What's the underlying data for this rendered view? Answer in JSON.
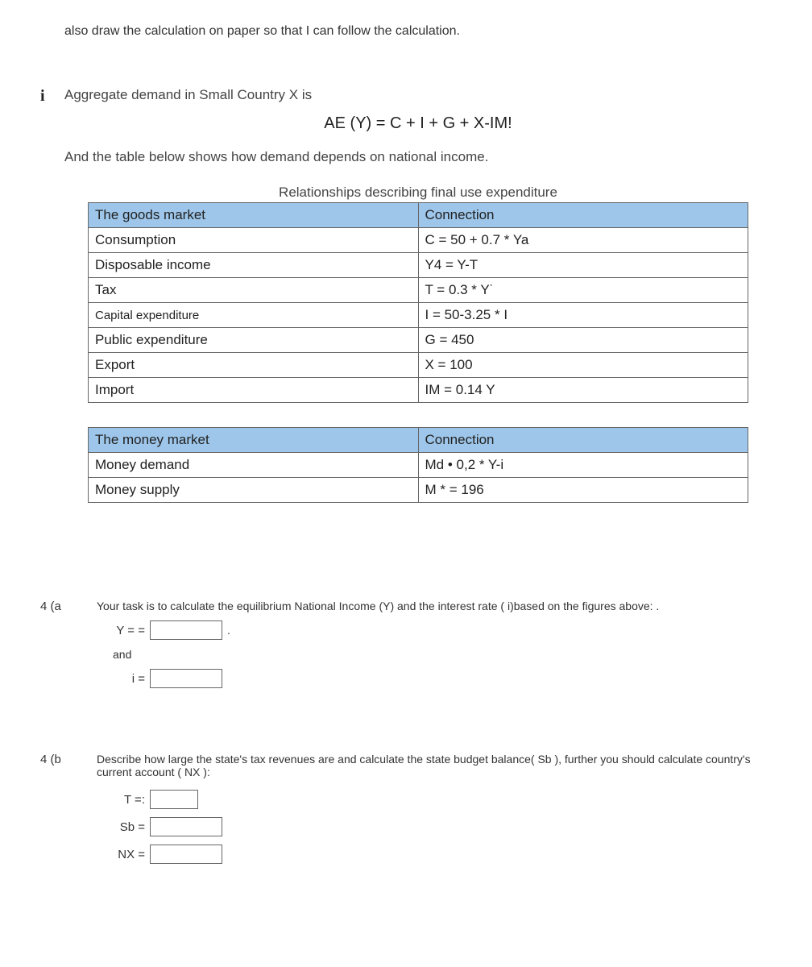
{
  "top_note": "also draw the calculation on paper so that I can follow the calculation.",
  "info": {
    "marker": "i",
    "line1": "Aggregate demand in Small Country X is",
    "equation": "AE (Y) = C + I + G + X-IM!",
    "line2": "And the table below shows how demand depends on national income.",
    "table_title": "Relationships describing final use expenditure"
  },
  "goods_table": {
    "header": {
      "left": "The goods market",
      "right": "Connection"
    },
    "rows": [
      {
        "left": "Consumption",
        "right": "C = 50 + 0.7 * Ya"
      },
      {
        "left": "Disposable income",
        "right": "Y4 = Y-T"
      },
      {
        "left": "Tax",
        "right": "T = 0.3 * Y˙"
      },
      {
        "left": "Capital expenditure",
        "right": "I = 50-3.25 * I",
        "small_left": true
      },
      {
        "left": "Public expenditure",
        "right": "G = 450"
      },
      {
        "left": "Export",
        "right": "X = 100"
      },
      {
        "left": "Import",
        "right": "IM = 0.14 Y"
      }
    ]
  },
  "money_table": {
    "header": {
      "left": "The money market",
      "right": "Connection"
    },
    "rows": [
      {
        "left": "Money demand",
        "right": "Md • 0,2 * Y-i"
      },
      {
        "left": "Money supply",
        "right": "M * = 196"
      }
    ]
  },
  "q4a": {
    "label": "4 (a",
    "text": "Your task is to calculate the equilibrium National Income (Y) and the interest rate ( i)based on the figures above: .",
    "y_label": "Y = =",
    "and": "and",
    "i_label": "i ="
  },
  "q4b": {
    "label": "4 (b",
    "text": "Describe how large the state's tax revenues are and calculate the state budget balance( Sb ), further you should calculate country's current account ( NX ):",
    "t_label": "T =:",
    "sb_label": "Sb =",
    "nx_label": "NX ="
  }
}
